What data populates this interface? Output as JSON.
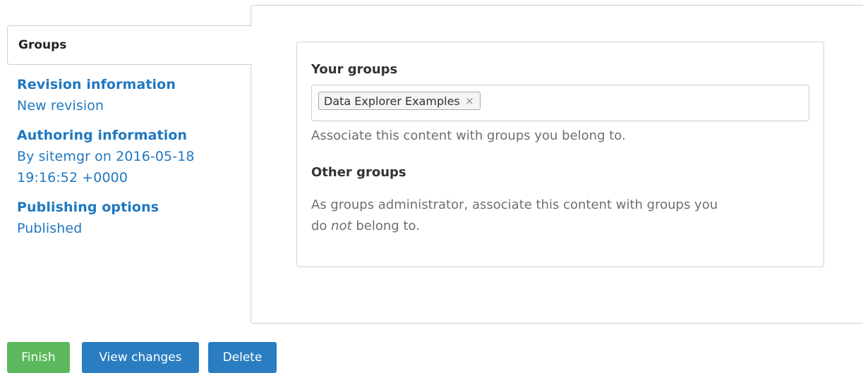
{
  "tabs": {
    "groups": {
      "title": "Groups"
    },
    "revision": {
      "title": "Revision information",
      "summary": "New revision"
    },
    "authoring": {
      "title": "Authoring information",
      "summary_line1": "By sitemgr on 2016-05-18",
      "summary_line2": "19:16:52 +0000"
    },
    "publishing": {
      "title": "Publishing options",
      "summary": "Published"
    }
  },
  "groups_panel": {
    "your_groups_label": "Your groups",
    "selected_groups": [
      "Data Explorer Examples"
    ],
    "remove_glyph": "×",
    "your_groups_description": "Associate this content with groups you belong to.",
    "other_groups_label": "Other groups",
    "other_groups_description_before": "As groups administrator, associate this content with groups you",
    "other_groups_description_pre_em": "do ",
    "other_groups_description_em": "not",
    "other_groups_description_after": " belong to."
  },
  "actions": {
    "finish_label": "Finish",
    "view_changes_label": "View changes",
    "delete_label": "Delete"
  },
  "colors": {
    "link": "#1f78c1",
    "finish": "#5cb85c",
    "primary": "#2b7dc1"
  }
}
